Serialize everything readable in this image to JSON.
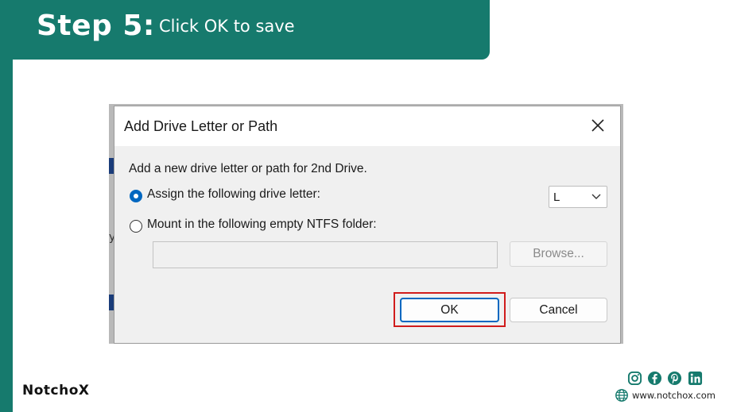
{
  "header": {
    "step_title": "Step 5:",
    "step_description": "Click OK to save"
  },
  "dialog": {
    "title": "Add Drive Letter or Path",
    "prompt": "Add a new drive letter or path for 2nd Drive.",
    "option_assign_label": "Assign the following drive letter:",
    "option_assign_selected": true,
    "drive_letter_value": "L",
    "option_mount_label": "Mount in the following empty NTFS folder:",
    "option_mount_selected": false,
    "folder_path_value": "",
    "browse_label": "Browse...",
    "ok_label": "OK",
    "cancel_label": "Cancel",
    "highlighted_button": "OK"
  },
  "footer": {
    "logo_text": "NotchoX",
    "social_icons": [
      "instagram-icon",
      "facebook-icon",
      "pinterest-icon",
      "linkedin-icon"
    ],
    "website": "www.notchox.com"
  },
  "colors": {
    "brand_teal": "#167a6d",
    "highlight_red": "#d01c1c",
    "accent_blue": "#0067c0"
  }
}
